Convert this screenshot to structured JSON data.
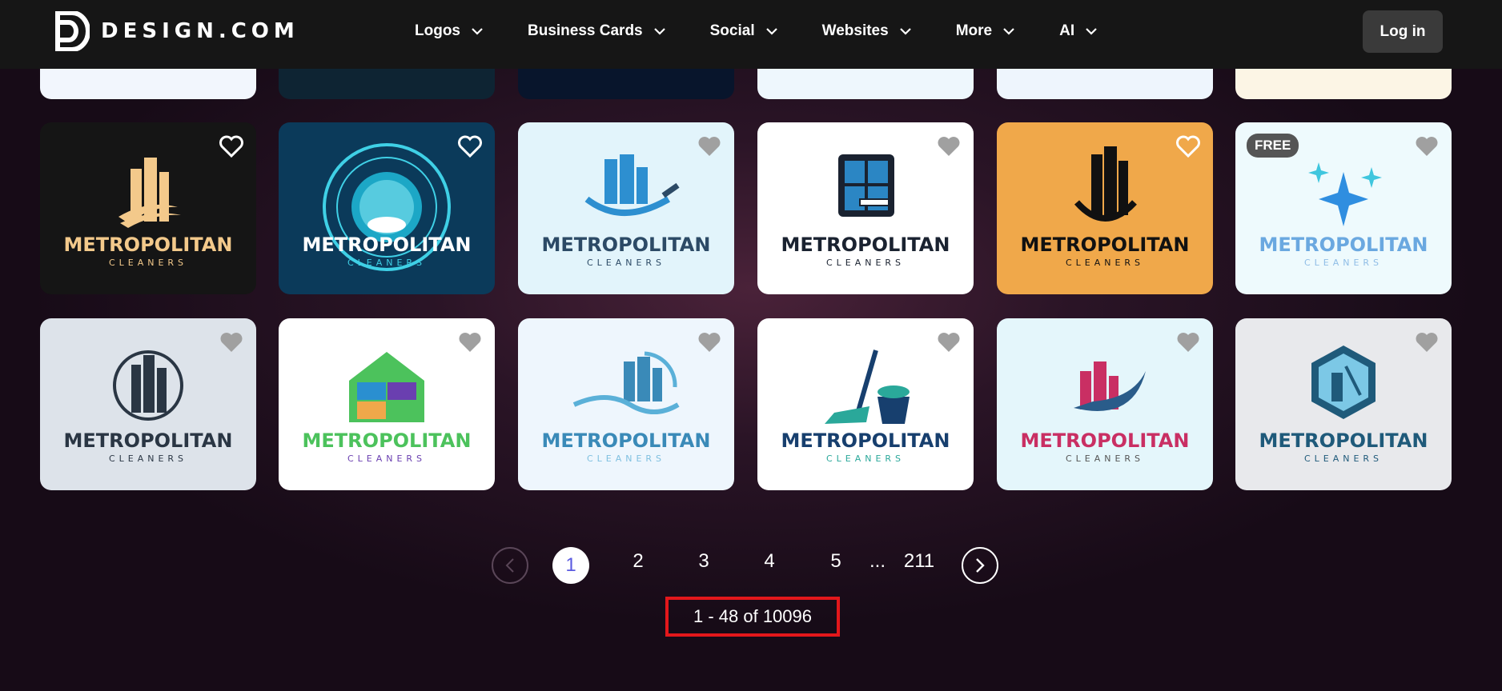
{
  "brand": {
    "name": "DESIGN.COM"
  },
  "nav": {
    "items": [
      {
        "label": "Logos"
      },
      {
        "label": "Business Cards"
      },
      {
        "label": "Social"
      },
      {
        "label": "Websites"
      },
      {
        "label": "More"
      },
      {
        "label": "AI"
      }
    ],
    "login_label": "Log in"
  },
  "cards": {
    "free_badge": "FREE",
    "name_main": "METROPOLITAN",
    "name_sub": "CLEANERS",
    "top_row_colors": [
      "#f2f6fd",
      "#0e2433",
      "#08152c",
      "#eef7fd",
      "#eef5fd",
      "#fcf5e5"
    ],
    "items": [
      {
        "bg": "#151515",
        "title_color": "#f3c98b",
        "sub_color": "#f3c98b",
        "icon": "golden-buildings"
      },
      {
        "bg": "#0b3a5a",
        "title_color": "#ffffff",
        "sub_color": "#3fd0e6",
        "icon": "round-badge"
      },
      {
        "bg": "#e2f4fb",
        "title_color": "#2c4a66",
        "sub_color": "#2c4a66",
        "icon": "squeegee-city"
      },
      {
        "bg": "#ffffff",
        "title_color": "#1a2230",
        "sub_color": "#1a2230",
        "icon": "window-squeegee"
      },
      {
        "bg": "#f0a84a",
        "title_color": "#111111",
        "sub_color": "#111111",
        "icon": "black-buildings"
      },
      {
        "bg": "#eefafd",
        "title_color": "#6aa8e0",
        "sub_color": "#8fbde6",
        "icon": "sparkles",
        "free": true
      },
      {
        "bg": "#dde3ea",
        "title_color": "#2a3644",
        "sub_color": "#2a3644",
        "icon": "circle-city"
      },
      {
        "bg": "#ffffff",
        "title_color": "#4cc25c",
        "sub_color": "#6a3fb0",
        "icon": "house-tools"
      },
      {
        "bg": "#eef6fd",
        "title_color": "#3a8ab8",
        "sub_color": "#7fc0e0",
        "icon": "wave-city"
      },
      {
        "bg": "#ffffff",
        "title_color": "#173f6e",
        "sub_color": "#2aa89a",
        "icon": "broom-bucket"
      },
      {
        "bg": "#e4f6fb",
        "title_color": "#c92f63",
        "sub_color": "#555555",
        "icon": "pink-swoosh"
      },
      {
        "bg": "#e8e9ec",
        "title_color": "#1f5a7a",
        "sub_color": "#1f5a7a",
        "icon": "hex-window"
      }
    ]
  },
  "pagination": {
    "pages": [
      "1",
      "2",
      "3",
      "4",
      "5"
    ],
    "ellipsis": "...",
    "last": "211",
    "current": "1",
    "summary": "1 - 48 of 10096"
  },
  "colors": {
    "accent": "#5a5ae0",
    "highlight": "#e3171b",
    "topbar": "#161616"
  }
}
